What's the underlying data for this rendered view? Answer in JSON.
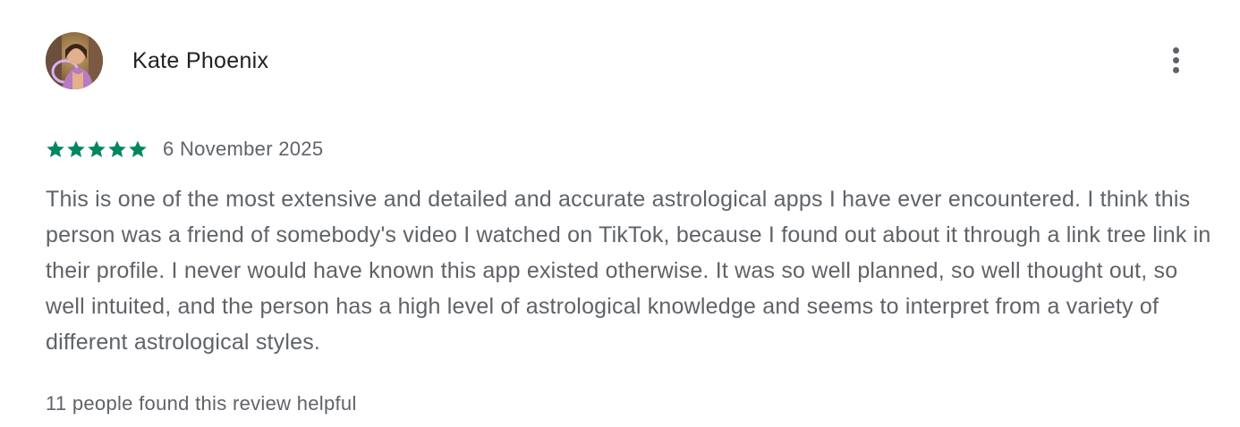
{
  "review": {
    "author_name": "Kate Phoenix",
    "avatar_icon": "user-avatar-photo",
    "more_options_icon": "more-vert-icon",
    "rating": {
      "stars_filled": 5,
      "stars_total": 5,
      "star_color": "#01875f"
    },
    "date": "6 November 2025",
    "body": "This is one of the most extensive and detailed and accurate astrological apps I have ever encountered. I think this person was a friend of somebody's video I watched on TikTok, because I found out about it through a link tree link in their profile. I never would have known this app existed otherwise. It was so well planned, so well thought out, so well intuited, and the person has a high level of astrological knowledge and seems to interpret from a variety of different astrological styles.",
    "helpful_text": "11 people found this review helpful"
  }
}
